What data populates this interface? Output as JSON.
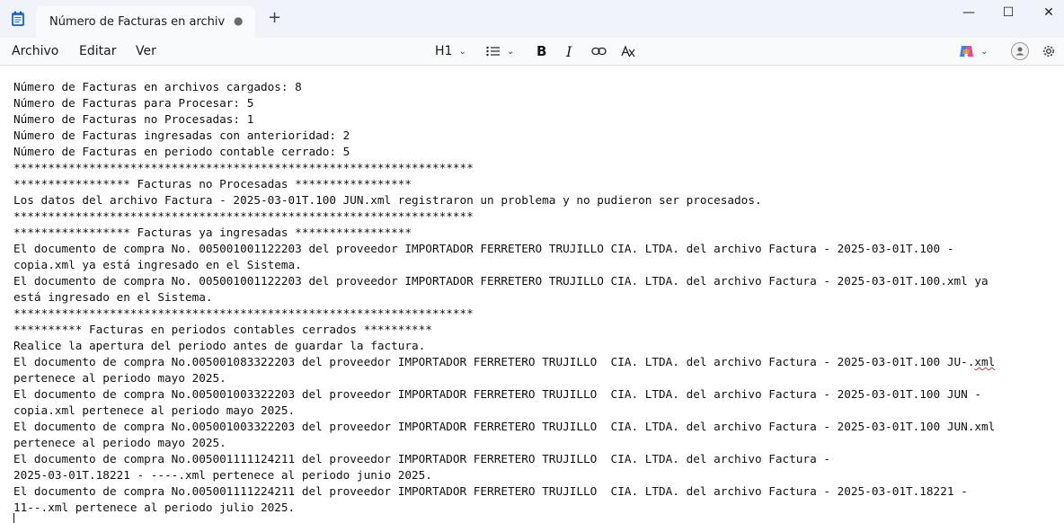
{
  "tab": {
    "title": "Número de Facturas en archivos ca",
    "unsaved_dot": "●",
    "new_tab_label": "+"
  },
  "window": {
    "minimize": "—",
    "maximize": "☐",
    "close": "✕"
  },
  "menu": {
    "file": "Archivo",
    "edit": "Editar",
    "view": "Ver"
  },
  "toolbar": {
    "heading_label": "H1",
    "heading_chevron": "⌄",
    "list_chevron": "⌄",
    "copilot_chevron": "⌄",
    "bold": "B",
    "italic": "I"
  },
  "document": {
    "lines": [
      "Número de Facturas en archivos cargados: 8",
      "Número de Facturas para Procesar: 5",
      "Número de Facturas no Procesadas: 1",
      "Número de Facturas ingresadas con anterioridad: 2",
      "Número de Facturas en periodo contable cerrado: 5",
      "*******************************************************************",
      "***************** Facturas no Procesadas *****************",
      "Los datos del archivo Factura - 2025-03-01T.100 JUN.xml registraron un problema y no pudieron ser procesados.",
      "*******************************************************************",
      "***************** Facturas ya ingresadas *****************",
      "El documento de compra No. 005001001122203 del proveedor IMPORTADOR FERRETERO TRUJILLO CIA. LTDA. del archivo Factura - 2025-03-01T.100 -",
      "copia.xml ya está ingresado en el Sistema.",
      "El documento de compra No. 005001001122203 del proveedor IMPORTADOR FERRETERO TRUJILLO CIA. LTDA. del archivo Factura - 2025-03-01T.100.xml ya",
      "está ingresado en el Sistema.",
      "*******************************************************************",
      "********** Facturas en periodos contables cerrados **********",
      "Realice la apertura del periodo antes de guardar la factura.",
      "El documento de compra No.005001083322203 del proveedor IMPORTADOR FERRETERO TRUJILLO  CIA. LTDA. del archivo Factura - 2025-03-01T.100 JU-.",
      "pertenece al periodo mayo 2025.",
      "El documento de compra No.005001003322203 del proveedor IMPORTADOR FERRETERO TRUJILLO  CIA. LTDA. del archivo Factura - 2025-03-01T.100 JUN -",
      "copia.xml pertenece al periodo mayo 2025.",
      "El documento de compra No.005001003322203 del proveedor IMPORTADOR FERRETERO TRUJILLO  CIA. LTDA. del archivo Factura - 2025-03-01T.100 JUN.xml",
      "pertenece al periodo mayo 2025.",
      "El documento de compra No.005001111124211 del proveedor IMPORTADOR FERRETERO TRUJILLO  CIA. LTDA. del archivo Factura -",
      "2025-03-01T.18221 - ----.xml pertenece al periodo junio 2025.",
      "El documento de compra No.005001111224211 del proveedor IMPORTADOR FERRETERO TRUJILLO  CIA. LTDA. del archivo Factura - 2025-03-01T.18221 -",
      "11--.xml pertenece al periodo julio 2025."
    ],
    "squiggle_word": "xml"
  }
}
